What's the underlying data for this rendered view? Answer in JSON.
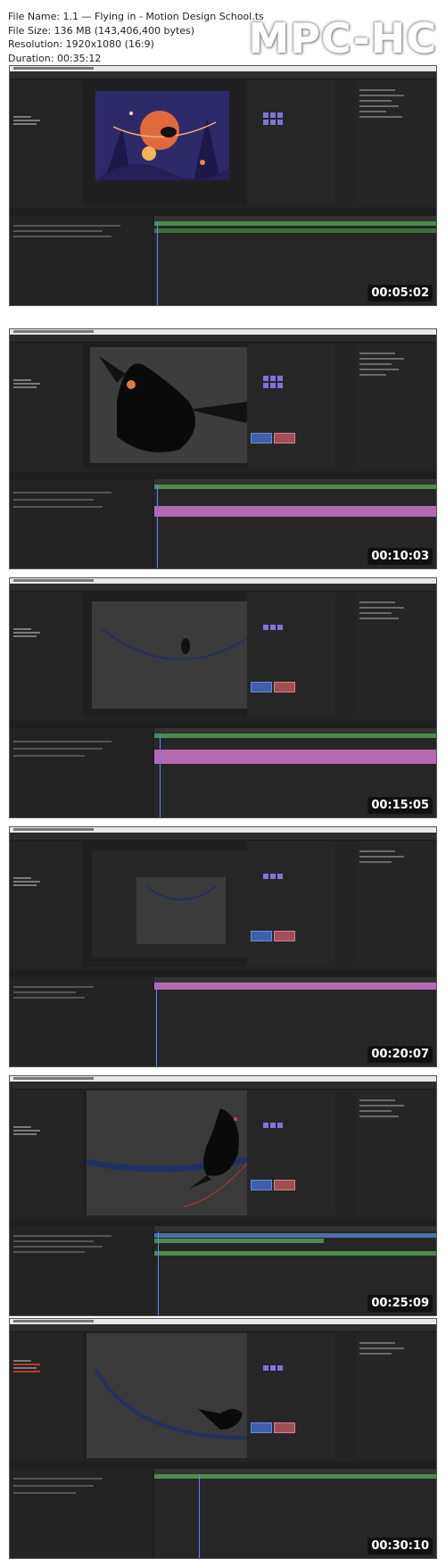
{
  "file_info": {
    "name": "File Name: 1.1 — Flying in - Motion Design School.ts",
    "size": "File Size: 136 MB (143,406,400 bytes)",
    "resolution": "Resolution: 1920x1080 (16:9)",
    "duration": "Duration: 00:35:12"
  },
  "logo": "MPC-HC",
  "thumbnails": [
    {
      "timestamp": "00:05:02",
      "scene": "illustration"
    },
    {
      "timestamp": "00:10:03",
      "scene": "bird-closeup"
    },
    {
      "timestamp": "00:15:05",
      "scene": "wire-small-bird"
    },
    {
      "timestamp": "00:20:07",
      "scene": "wire-box"
    },
    {
      "timestamp": "00:25:09",
      "scene": "bird-on-wire-large"
    },
    {
      "timestamp": "00:30:10",
      "scene": "bird-on-curve"
    }
  ],
  "colors": {
    "ui_bg": "#232323",
    "accent_blue": "#5b83ff",
    "track_green": "#4e8a4e",
    "track_pink": "#b46ab0",
    "wire": "#22305e"
  }
}
